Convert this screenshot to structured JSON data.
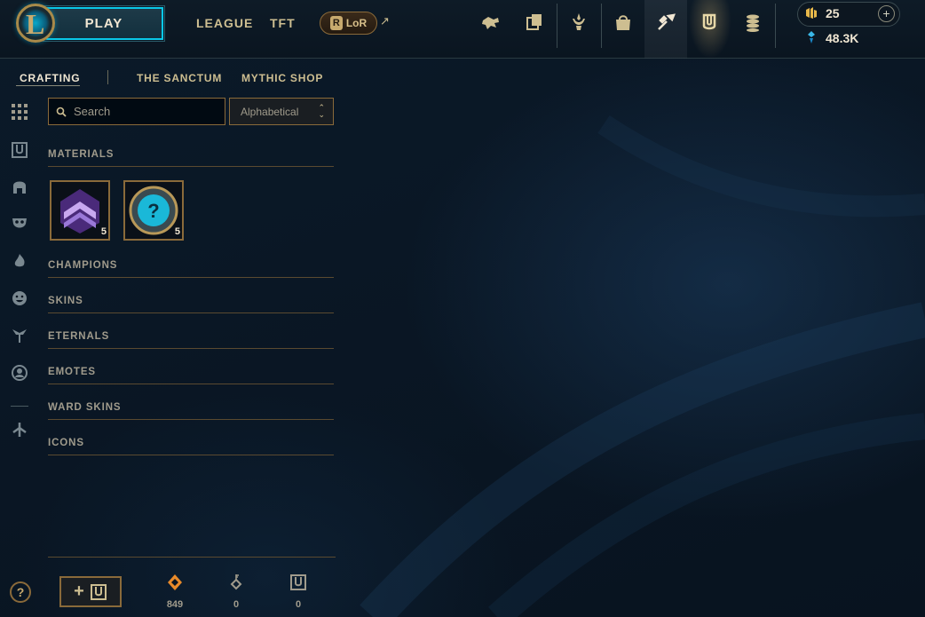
{
  "header": {
    "play_label": "PLAY",
    "nav": [
      "LEAGUE",
      "TFT"
    ],
    "lor_label": "LoR",
    "lor_letter": "R",
    "top_icons": [
      "profile-icon",
      "collection-icon",
      "loot-trophy-icon",
      "store-icon",
      "crafting-icon",
      "hextech-chest-icon",
      "currency-stack-icon"
    ],
    "rp_amount": "25",
    "be_amount": "48.3K",
    "add_label": "+"
  },
  "subnav": {
    "items": [
      "CRAFTING",
      "THE SANCTUM",
      "MYTHIC SHOP"
    ],
    "active": "CRAFTING"
  },
  "rail": {
    "icons": [
      "all-grid-icon",
      "chest-icon",
      "champion-helmet-icon",
      "skin-mask-icon",
      "eternals-flame-icon",
      "emote-face-icon",
      "ward-icon",
      "profile-icon-icon",
      "misc-arrow-icon"
    ]
  },
  "search": {
    "placeholder": "Search"
  },
  "sort": {
    "selected": "Alphabetical"
  },
  "sections": {
    "materials": "MATERIALS",
    "champions": "CHAMPIONS",
    "skins": "SKINS",
    "eternals": "ETERNALS",
    "emotes": "EMOTES",
    "ward_skins": "WARD SKINS",
    "icons": "ICONS"
  },
  "materials": [
    {
      "name": "mythic-essence-icon",
      "count": "5"
    },
    {
      "name": "mystery-token-icon",
      "count": "5"
    }
  ],
  "footer": {
    "help": "?",
    "add_chest_plus": "+",
    "orange_essence": "849",
    "keys": "0",
    "chests": "0"
  }
}
